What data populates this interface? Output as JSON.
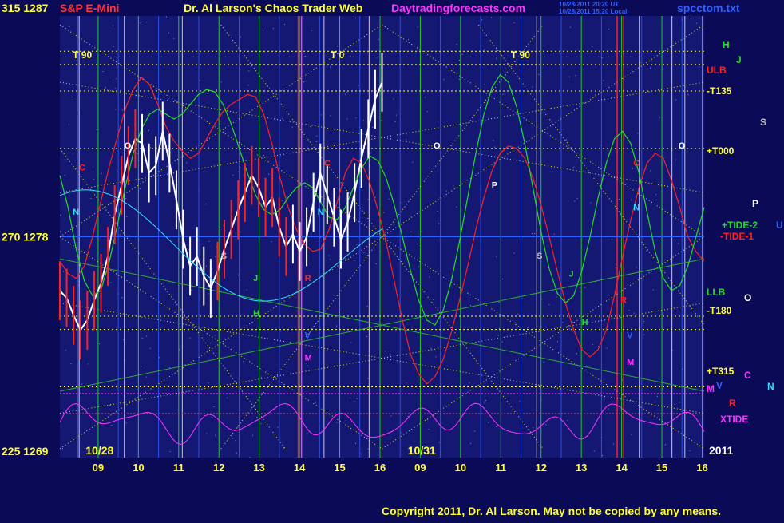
{
  "header": {
    "left_price_label": "315  1287",
    "instrument": "S&P E-Mini",
    "title": "Dr. Al Larson's Chaos Trader Web",
    "site": "Daytradingforecasts.com",
    "timestamp_line1": "10/28/2011 20:20 UT",
    "timestamp_line2": "10/28/2011 15:20 Local",
    "file": "spcctom.txt"
  },
  "footer": {
    "copyright": "Copyright 2011, Dr. Al Larson. May not be copied by any means."
  },
  "colors": {
    "background": "#0a0a56",
    "plot_area": "#141873",
    "yellow": "#ffff33",
    "white": "#ffffff",
    "red": "#ff2020",
    "green": "#22dd22",
    "blue": "#3060ff",
    "magenta": "#ff33ff",
    "cyan": "#33ddff",
    "title_red": "#ff3333"
  },
  "chart_data": {
    "type": "line",
    "y_axis_left": [
      {
        "value": 1287,
        "label": "315  1287"
      },
      {
        "value": 1278,
        "label": "270  1278"
      },
      {
        "value": 1269,
        "label": "225  1269"
      }
    ],
    "ylim": [
      1269,
      1287
    ],
    "x_axis": {
      "hours": [
        "09",
        "10",
        "11",
        "12",
        "13",
        "14",
        "15",
        "16",
        "09",
        "10",
        "11",
        "12",
        "13",
        "14",
        "15",
        "16"
      ],
      "date_labels": [
        "10/28",
        "10/31"
      ],
      "year_label": "2011"
    },
    "top_markers": [
      "T 90",
      "T 0",
      "T 90"
    ],
    "right_labels": [
      {
        "text": "H",
        "color": "#22dd22"
      },
      {
        "text": "J",
        "color": "#22dd22"
      },
      {
        "text": "ULB",
        "color": "#ff2020"
      },
      {
        "text": "-T135",
        "color": "#ffff33"
      },
      {
        "text": "S",
        "color": "#bbbbbb"
      },
      {
        "text": "+T000",
        "color": "#ffff33"
      },
      {
        "text": "P",
        "color": "#ffffff"
      },
      {
        "text": "+TIDE-2",
        "color": "#22dd22"
      },
      {
        "text": "-TIDE-1",
        "color": "#ff2020"
      },
      {
        "text": "U",
        "color": "#3060ff"
      },
      {
        "text": "LLB",
        "color": "#22dd22"
      },
      {
        "text": "O",
        "color": "#ffffff"
      },
      {
        "text": "-T180",
        "color": "#ffff33"
      },
      {
        "text": "+T315",
        "color": "#ffff33"
      },
      {
        "text": "C",
        "color": "#ff33ff"
      },
      {
        "text": "N",
        "color": "#33ddff"
      },
      {
        "text": "M",
        "color": "#ff33ff"
      },
      {
        "text": "V",
        "color": "#3060ff"
      },
      {
        "text": "R",
        "color": "#ff2020"
      },
      {
        "text": "XTIDE",
        "color": "#ff33ff"
      }
    ],
    "plot_letters": [
      {
        "text": "O",
        "color": "#ffffff"
      },
      {
        "text": "C",
        "color": "#ff2020"
      },
      {
        "text": "N",
        "color": "#33ddff"
      },
      {
        "text": "S",
        "color": "#bbbbbb"
      },
      {
        "text": "J",
        "color": "#22dd22"
      },
      {
        "text": "H",
        "color": "#22dd22"
      },
      {
        "text": "R",
        "color": "#ff2020"
      },
      {
        "text": "M",
        "color": "#ff33ff"
      },
      {
        "text": "V",
        "color": "#3060ff"
      },
      {
        "text": "C",
        "color": "#ff2020"
      },
      {
        "text": "N",
        "color": "#33ddff"
      },
      {
        "text": "O",
        "color": "#ffffff"
      },
      {
        "text": "P",
        "color": "#ffffff"
      },
      {
        "text": "S",
        "color": "#bbbbbb"
      },
      {
        "text": "J",
        "color": "#22dd22"
      },
      {
        "text": "H",
        "color": "#22dd22"
      },
      {
        "text": "R",
        "color": "#ff2020"
      },
      {
        "text": "M",
        "color": "#ff33ff"
      },
      {
        "text": "V",
        "color": "#3060ff"
      },
      {
        "text": "O",
        "color": "#ffffff"
      },
      {
        "text": "C",
        "color": "#ff2020"
      },
      {
        "text": "N",
        "color": "#33ddff"
      }
    ],
    "series": [
      {
        "name": "Price",
        "color": "#ffffff",
        "values": [
          1275.8,
          1275.5,
          1274.8,
          1274.2,
          1274.6,
          1275.4,
          1276.1,
          1277.2,
          1278.9,
          1280.1,
          1281.3,
          1282.0,
          1281.8,
          1280.6,
          1280.9,
          1282.3,
          1281.0,
          1279.5,
          1277.9,
          1276.8,
          1277.2,
          1276.4,
          1275.9,
          1276.6,
          1277.5,
          1278.3,
          1279.1,
          1279.8,
          1280.5,
          1280.0,
          1279.2,
          1279.6,
          1278.4,
          1277.6,
          1278.1,
          1277.4,
          1278.0,
          1279.4,
          1280.6,
          1279.7,
          1278.8,
          1277.9,
          1278.6,
          1279.8,
          1281.2,
          1282.4,
          1283.6,
          1284.3
        ]
      },
      {
        "name": "Tide1",
        "color": "#ff2020",
        "values": [
          1277.0,
          1276.5,
          1276.3,
          1276.8,
          1278.0,
          1279.4,
          1280.8,
          1282.0,
          1283.2,
          1284.0,
          1284.5,
          1284.2,
          1283.4,
          1282.5,
          1281.9,
          1281.5,
          1281.2,
          1281.4,
          1282.0,
          1282.6,
          1283.1,
          1283.4,
          1283.6,
          1283.8,
          1283.7,
          1283.0,
          1281.8,
          1280.4,
          1279.2,
          1278.3,
          1277.7,
          1277.4,
          1277.5,
          1278.3,
          1279.4,
          1280.6,
          1281.2,
          1281.0,
          1280.2,
          1279.1,
          1277.8,
          1276.2,
          1274.6,
          1273.2,
          1272.4,
          1272.0,
          1272.3,
          1273.0,
          1274.1,
          1275.4,
          1276.8,
          1278.3,
          1279.6,
          1280.7,
          1281.4,
          1281.7,
          1281.6,
          1281.2,
          1280.4,
          1279.3,
          1278.0,
          1276.6,
          1275.3,
          1274.2,
          1273.4,
          1273.1,
          1273.4,
          1274.2,
          1275.6,
          1277.2,
          1278.7,
          1280.0,
          1281.0,
          1281.4,
          1281.2,
          1280.3,
          1279.2,
          1278.0,
          1277.4,
          1277.0
        ]
      },
      {
        "name": "Tide2",
        "color": "#22dd22",
        "values": [
          1280.5,
          1279.2,
          1277.5,
          1276.2,
          1275.6,
          1275.8,
          1276.9,
          1278.4,
          1280.0,
          1281.4,
          1282.4,
          1283.0,
          1283.2,
          1283.0,
          1282.8,
          1283.0,
          1283.4,
          1283.8,
          1284.0,
          1283.9,
          1283.4,
          1282.6,
          1281.6,
          1280.6,
          1279.7,
          1279.1,
          1278.9,
          1279.1,
          1279.6,
          1280.0,
          1280.2,
          1280.0,
          1279.4,
          1278.8,
          1278.7,
          1279.2,
          1280.0,
          1280.8,
          1281.3,
          1281.1,
          1280.4,
          1279.3,
          1278.0,
          1276.6,
          1275.4,
          1274.6,
          1274.4,
          1275.0,
          1276.2,
          1277.8,
          1279.6,
          1281.4,
          1283.0,
          1284.1,
          1284.6,
          1284.3,
          1283.3,
          1281.8,
          1280.0,
          1278.2,
          1276.7,
          1275.7,
          1275.3,
          1275.6,
          1276.6,
          1278.0,
          1279.6,
          1281.0,
          1282.0,
          1282.3,
          1281.8,
          1280.6,
          1279.0,
          1277.4,
          1276.3,
          1275.8,
          1276.0,
          1276.8,
          1278.0,
          1279.2
        ]
      }
    ],
    "legend": "none",
    "grid": true
  }
}
